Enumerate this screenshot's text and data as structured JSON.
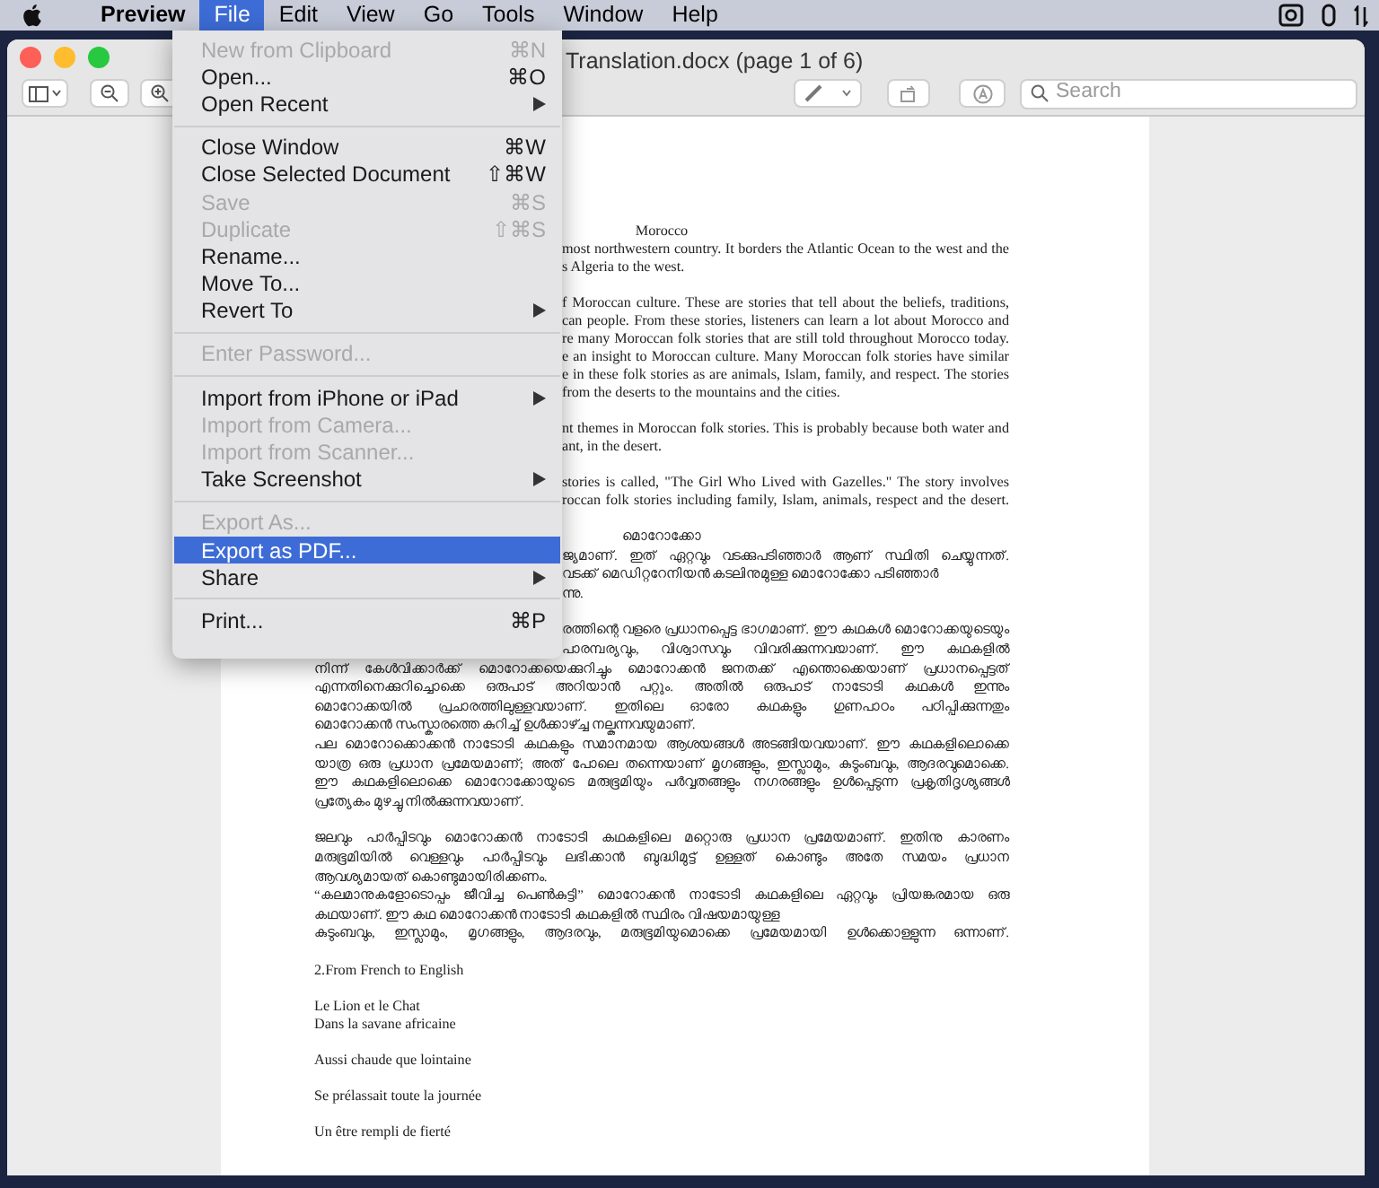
{
  "menu_bar": {
    "items": [
      {
        "label": "Preview",
        "kind": "app",
        "selected": false
      },
      {
        "label": "File",
        "kind": "menu",
        "selected": true
      },
      {
        "label": "Edit",
        "kind": "menu",
        "selected": false
      },
      {
        "label": "View",
        "kind": "menu",
        "selected": false
      },
      {
        "label": "Go",
        "kind": "menu",
        "selected": false
      },
      {
        "label": "Tools",
        "kind": "menu",
        "selected": false
      },
      {
        "label": "Window",
        "kind": "menu",
        "selected": false
      },
      {
        "label": "Help",
        "kind": "menu",
        "selected": false
      }
    ]
  },
  "window": {
    "title": "Translation.docx (page 1 of 6)",
    "search": {
      "placeholder": "Search"
    }
  },
  "file_menu": {
    "items": [
      {
        "kind": "item",
        "label": "New from Clipboard",
        "shortcut": "⌘N",
        "disabled": true,
        "selected": false,
        "submenu": false
      },
      {
        "kind": "item",
        "label": "Open...",
        "shortcut": "⌘O",
        "disabled": false,
        "selected": false,
        "submenu": false
      },
      {
        "kind": "item",
        "label": "Open Recent",
        "disabled": false,
        "selected": false,
        "submenu": true
      },
      {
        "kind": "separator"
      },
      {
        "kind": "item",
        "label": "Close Window",
        "shortcut": "⌘W",
        "disabled": false,
        "selected": false,
        "submenu": false
      },
      {
        "kind": "item",
        "label": "Close Selected Document",
        "shortcut": "⇧⌘W",
        "disabled": false,
        "selected": false,
        "submenu": false
      },
      {
        "kind": "item",
        "label": "Save",
        "shortcut": "⌘S",
        "disabled": true,
        "selected": false,
        "submenu": false
      },
      {
        "kind": "item",
        "label": "Duplicate",
        "shortcut": "⇧⌘S",
        "disabled": true,
        "selected": false,
        "submenu": false
      },
      {
        "kind": "item",
        "label": "Rename...",
        "disabled": false,
        "selected": false,
        "submenu": false
      },
      {
        "kind": "item",
        "label": "Move To...",
        "disabled": false,
        "selected": false,
        "submenu": false
      },
      {
        "kind": "item",
        "label": "Revert To",
        "disabled": false,
        "selected": false,
        "submenu": true
      },
      {
        "kind": "separator"
      },
      {
        "kind": "item",
        "label": "Enter Password...",
        "disabled": true,
        "selected": false,
        "submenu": false
      },
      {
        "kind": "separator"
      },
      {
        "kind": "item",
        "label": "Import from iPhone or iPad",
        "disabled": false,
        "selected": false,
        "submenu": true
      },
      {
        "kind": "item",
        "label": "Import from Camera...",
        "disabled": true,
        "selected": false,
        "submenu": false
      },
      {
        "kind": "item",
        "label": "Import from Scanner...",
        "disabled": true,
        "selected": false,
        "submenu": false
      },
      {
        "kind": "item",
        "label": "Take Screenshot",
        "disabled": false,
        "selected": false,
        "submenu": true
      },
      {
        "kind": "separator"
      },
      {
        "kind": "item",
        "label": "Export As...",
        "disabled": true,
        "selected": false,
        "submenu": false
      },
      {
        "kind": "item",
        "label": "Export as PDF...",
        "disabled": false,
        "selected": true,
        "submenu": false
      },
      {
        "kind": "item",
        "label": "Share",
        "disabled": false,
        "selected": false,
        "submenu": true
      },
      {
        "kind": "separator"
      },
      {
        "kind": "item",
        "label": "Print...",
        "shortcut": "⌘P",
        "disabled": false,
        "selected": false,
        "submenu": false
      }
    ]
  },
  "document": {
    "paragraphs": [
      {
        "kind": "latin",
        "lines": [
          {
            "kind": "heading",
            "text": "Morocco"
          },
          {
            "kind": "partial",
            "text": "most northwestern country. It borders the Atlantic Ocean to the west and the"
          },
          {
            "kind": "partial_tail",
            "text": "s Algeria to the west."
          }
        ]
      },
      {
        "kind": "latin",
        "lines": [
          {
            "kind": "partial",
            "text": "f Moroccan culture. These are stories that tell about the beliefs, traditions,"
          },
          {
            "kind": "partial",
            "text": "can people. From these stories, listeners can learn a lot about Morocco and"
          },
          {
            "kind": "partial",
            "text": "re many Moroccan folk stories that are still told throughout Morocco today."
          },
          {
            "kind": "partial",
            "text": "e an insight to Moroccan culture. Many Moroccan folk stories have similar"
          },
          {
            "kind": "partial",
            "text": "e in these folk stories as are animals, Islam, family, and respect. The stories"
          },
          {
            "kind": "partial_tail",
            "text": "from the deserts to the mountains and the cities."
          }
        ]
      },
      {
        "kind": "latin",
        "lines": [
          {
            "kind": "partial",
            "text": "nt themes in Moroccan folk stories. This is probably because both water and"
          },
          {
            "kind": "partial_tail",
            "text": "ant, in the desert."
          }
        ]
      },
      {
        "kind": "latin",
        "lines": [
          {
            "kind": "partial",
            "text": "stories is called, \"The Girl Who Lived with Gazelles.\" The story involves"
          },
          {
            "kind": "partial",
            "text": "roccan folk stories including family, Islam, animals, respect and the desert."
          }
        ]
      },
      {
        "kind": "malayalam",
        "lines": [
          {
            "kind": "heading",
            "text": "മൊറോക്കോ"
          },
          {
            "kind": "partial",
            "text": "ജ്യമാണ്.  ഇത് ഏറ്റവും വടക്കുപടിഞ്ഞാർ ആണ് സ്ഥിതി ചെയ്യുന്നത്."
          },
          {
            "kind": "partial_tail",
            "text": "വടക്ക് മെഡിറ്ററേനിയൻ കടലിനുമുള്ള മൊറോക്കോ പടിഞ്ഞാർ"
          },
          {
            "kind": "partial_tail",
            "text": "ന്നു."
          }
        ]
      },
      {
        "kind": "malayalam",
        "lines": [
          {
            "kind": "partial",
            "text": "രത്തിന്റെ വളരെ പ്രധാനപ്പെട്ട ഭാഗമാണ്. ഈ കഥകൾ മൊറോക്കയുടെയും"
          },
          {
            "kind": "partial",
            "text": "പാരമ്പര്യവും, വിശ്വാസവും വിവരിക്കുന്നവയാണ്.  ഈ കഥകളിൽ"
          },
          {
            "kind": "line",
            "text": "നിന്ന് കേൾവിക്കാർക്ക് മൊറോക്കയെക്കുറിച്ചും മൊറോക്കൻ ജനതക്ക് എന്തൊക്കെയാണ് പ്രധാനപ്പെട്ടത്"
          },
          {
            "kind": "line",
            "text": "എന്നതിനെക്കുറിച്ചൊക്കെ ഒരുപാട് അറിയാൻ പറ്റും.  അതിൽ ഒരുപാട് നാടോടി കഥകൾ ഇന്നും"
          },
          {
            "kind": "line",
            "text": "മൊറോക്കയിൽ പ്രചാരത്തിലുള്ളവയാണ്.  ഇതിലെ ഓരോ കഥകളും ഗുണപാഠം പഠിപ്പിക്കുന്നതും"
          },
          {
            "kind": "tail",
            "text": "മൊറോക്കൻ സംസ്കാരത്തെ കുറിച്ച് ഉൾക്കാഴ്ച്ച നല്കുന്നവയുമാണ്."
          },
          {
            "kind": "line",
            "text": "പല മൊറോക്കൊക്കൻ നാടോടി കഥകളും സമാനമായ ആശയങ്ങൾ അടങ്ങിയവയാണ്.  ഈ കഥകളിലൊക്കെ"
          },
          {
            "kind": "line",
            "text": "യാത്ര ഒരു പ്രധാന പ്രമേയമാണ്; അത് പോലെ തന്നെയാണ് മൃഗങ്ങളും, ഇസ്ലാമും, കുടുംബവും, ആദരവുമൊക്കെ."
          },
          {
            "kind": "line",
            "text": "ഈ കഥകളിലൊക്കെ മൊറോക്കോയുടെ മരുഭൂമിയും പർവ്വതങ്ങളും നഗരങ്ങളും ഉൾപ്പെടുന്ന പ്രകൃതിദൃശ്യങ്ങൾ"
          },
          {
            "kind": "tail",
            "text": "പ്രത്യേകം മുഴച്ചു നിൽക്കുന്നവയാണ്."
          }
        ]
      },
      {
        "kind": "malayalam",
        "lines": [
          {
            "kind": "line",
            "text": "ജലവും പാർപ്പിടവും മൊറോക്കൻ നാടോടി കഥകളിലെ മറ്റൊരു പ്രധാന പ്രമേയമാണ്. ഇതിനു കാരണം"
          },
          {
            "kind": "line",
            "text": "മരുഭൂമിയിൽ വെള്ളവും പാർപ്പിടവും ലഭിക്കാൻ ബുദ്ധിമുട്ട് ഉള്ളത് കൊണ്ടും അതേ സമയം പ്രധാന"
          },
          {
            "kind": "tail",
            "text": "ആവശ്യമായത് കൊണ്ടുമായിരിക്കണം."
          },
          {
            "kind": "line",
            "text": "“കലമാനുകളോടൊപ്പം ജീവിച്ച പെൺകുട്ടി” മൊറോക്കൻ നാടോടി കഥകളിലെ ഏറ്റവും പ്രിയങ്കരമായ ഒരു"
          },
          {
            "kind": "tail",
            "text": "കഥയാണ്.  ഈ കഥ മൊറോക്കൻ നാടോടി കഥകളിൽ സ്ഥിരം വിഷയമായുള്ള"
          },
          {
            "kind": "line",
            "text": "കുടുംബവും, ഇസ്ലാമും, മൃഗങ്ങളും,  ആദരവും,  മരുഭൂമിയുമൊക്കെ പ്രമേയമായി ഉൾക്കൊള്ളുന്ന ഒന്നാണ്."
          }
        ]
      },
      {
        "kind": "latin",
        "lines": [
          {
            "kind": "tail",
            "text": "2.From French to English"
          }
        ]
      },
      {
        "kind": "latin",
        "lines": [
          {
            "kind": "tail",
            "text": "Le Lion et le Chat"
          },
          {
            "kind": "tail",
            "text": "Dans la savane africaine"
          }
        ]
      },
      {
        "kind": "latin",
        "lines": [
          {
            "kind": "tail",
            "text": "Aussi chaude que lointaine"
          }
        ]
      },
      {
        "kind": "latin",
        "lines": [
          {
            "kind": "tail",
            "text": "Se prélassait toute la journée"
          }
        ]
      },
      {
        "kind": "latin",
        "lines": [
          {
            "kind": "tail",
            "text": "Un être rempli de fierté"
          }
        ]
      }
    ]
  }
}
